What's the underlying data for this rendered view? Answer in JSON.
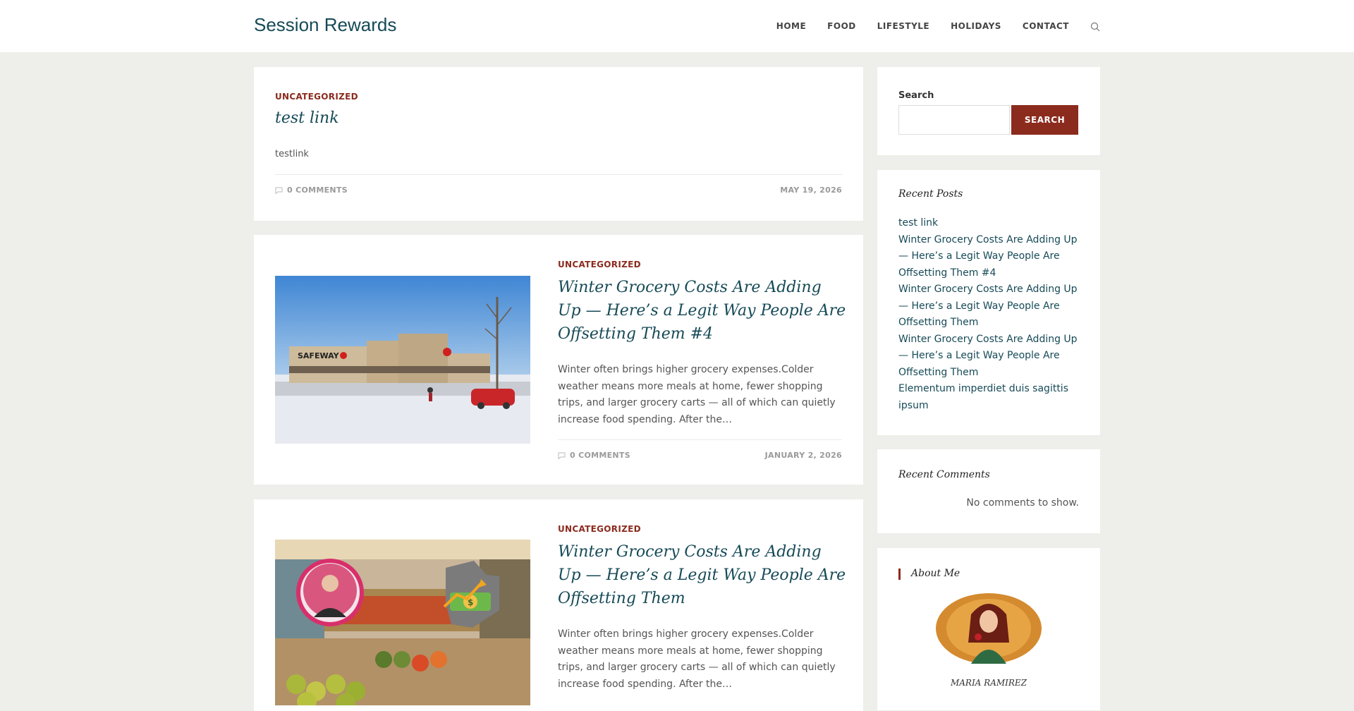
{
  "header": {
    "logo": "Session Rewards",
    "nav": [
      "HOME",
      "FOOD",
      "LIFESTYLE",
      "HOLIDAYS",
      "CONTACT"
    ],
    "search_icon": "search-icon"
  },
  "posts": [
    {
      "category": "UNCATEGORIZED",
      "title": "test link",
      "excerpt": "testlink",
      "comments": "0 COMMENTS",
      "date": "MAY 19, 2026"
    },
    {
      "category": "UNCATEGORIZED",
      "title": "Winter Grocery Costs Are Adding Up — Here’s a Legit Way People Are Offsetting Them #4",
      "excerpt": "Winter often brings higher grocery expenses.Colder weather means more meals at home, fewer shopping trips, and larger grocery carts — all of which can quietly increase food spending. After the…",
      "comments": "0 COMMENTS",
      "date": "JANUARY 2, 2026",
      "image_sign": "SAFEWAY"
    },
    {
      "category": "UNCATEGORIZED",
      "title": "Winter Grocery Costs Are Adding Up — Here’s a Legit Way People Are Offsetting Them",
      "excerpt": "Winter often brings higher grocery expenses.Colder weather means more meals at home, fewer shopping trips, and larger grocery carts — all of which can quietly increase food spending. After the…"
    }
  ],
  "sidebar": {
    "search": {
      "label": "Search",
      "button": "SEARCH",
      "placeholder": ""
    },
    "recent_posts": {
      "title": "Recent Posts",
      "items": [
        "test link",
        "Winter Grocery Costs Are Adding Up — Here’s a Legit Way People Are Offsetting Them #4",
        "Winter Grocery Costs Are Adding Up — Here’s a Legit Way People Are Offsetting Them",
        "Winter Grocery Costs Are Adding Up — Here’s a Legit Way People Are Offsetting Them",
        "Elementum imperdiet duis sagittis ipsum"
      ]
    },
    "recent_comments": {
      "title": "Recent Comments",
      "empty": "No comments to show."
    },
    "about": {
      "title": "About Me",
      "name": "MARIA RAMIREZ"
    }
  },
  "colors": {
    "accent": "#8b2b1e",
    "link": "#164a57",
    "background": "#eeeeea"
  }
}
